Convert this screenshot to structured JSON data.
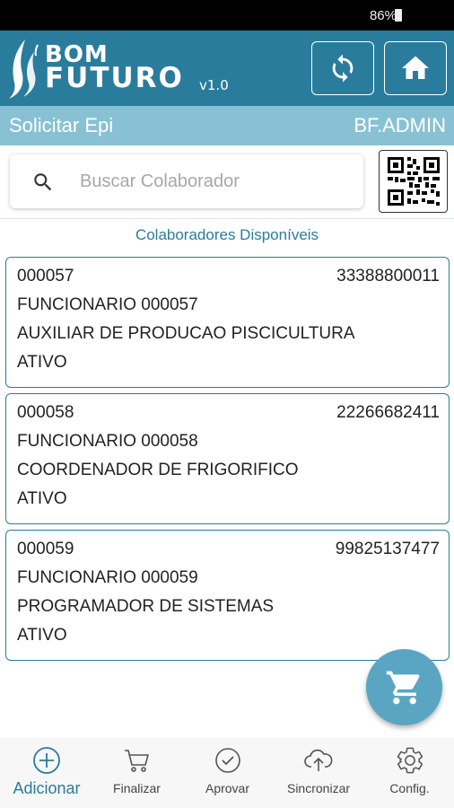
{
  "status_bar": {
    "battery": "86%"
  },
  "header": {
    "brand_line1": "BOM",
    "brand_line2": "FUTURO",
    "version": "v1.0"
  },
  "title_bar": {
    "title": "Solicitar Epi",
    "user": "BF.ADMIN"
  },
  "search": {
    "placeholder": "Buscar Colaborador",
    "value": ""
  },
  "section_label": "Colaboradores Disponíveis",
  "employees": [
    {
      "code": "000057",
      "phone": "33388800011",
      "name": "FUNCIONARIO 000057",
      "role": "AUXILIAR DE PRODUCAO PISCICULTURA",
      "status": "ATIVO"
    },
    {
      "code": "000058",
      "phone": "22266682411",
      "name": "FUNCIONARIO 000058",
      "role": "COORDENADOR DE FRIGORIFICO",
      "status": "ATIVO"
    },
    {
      "code": "000059",
      "phone": "99825137477",
      "name": "FUNCIONARIO 000059",
      "role": "PROGRAMADOR DE SISTEMAS",
      "status": "ATIVO"
    }
  ],
  "bottom_nav": {
    "add": "Adicionar",
    "finish": "Finalizar",
    "approve": "Aprovar",
    "sync": "Sincronizar",
    "config": "Config."
  },
  "colors": {
    "primary": "#2a7c9c",
    "title_bar": "#88c1d4",
    "fab": "#5aa6c2"
  },
  "icons": {
    "header": [
      "sync-icon",
      "home-icon"
    ],
    "search": "search-icon",
    "qr": "qr-code-icon",
    "fab": "cart-icon",
    "nav": [
      "add-circle-icon",
      "cart-outline-icon",
      "check-circle-icon",
      "cloud-upload-icon",
      "gear-icon"
    ]
  }
}
